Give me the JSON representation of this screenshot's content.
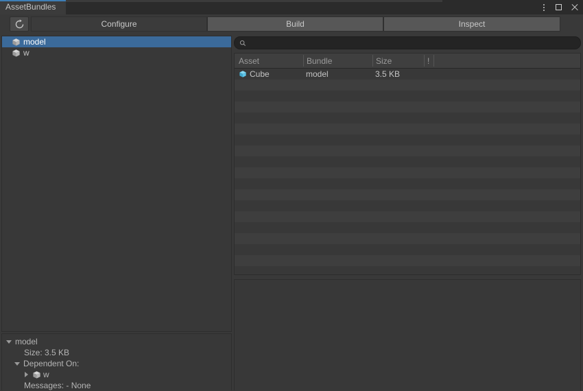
{
  "window": {
    "tab_title": "AssetBundles",
    "controls": {
      "menu": "kebab-menu",
      "maximize": "maximize",
      "close": "close"
    }
  },
  "toolbar": {
    "refresh_label": "Refresh",
    "modes": [
      {
        "label": "Configure",
        "selected": true
      },
      {
        "label": "Build",
        "selected": false
      },
      {
        "label": "Inspect",
        "selected": false
      }
    ]
  },
  "bundle_tree": {
    "items": [
      {
        "label": "model",
        "selected": true
      },
      {
        "label": "w",
        "selected": false
      }
    ]
  },
  "details": {
    "bundle_name": "model",
    "size_line": "Size: 3.5 KB",
    "dependent_on_label": "Dependent On:",
    "dependencies": [
      {
        "label": "w"
      }
    ],
    "messages_line": "Messages: - None"
  },
  "search": {
    "value": "",
    "placeholder": ""
  },
  "asset_list": {
    "columns": [
      "Asset",
      "Bundle",
      "Size",
      "!"
    ],
    "rows": [
      {
        "asset": "Cube",
        "bundle": "model",
        "size": "3.5 KB",
        "flag": ""
      }
    ],
    "empty_row_count": 18
  },
  "colors": {
    "accent": "#3e7eb5",
    "selection": "#3b6a9a",
    "panel_bg": "#383838",
    "window_bg": "#393939",
    "prefab_icon": "#5ec4e8"
  }
}
